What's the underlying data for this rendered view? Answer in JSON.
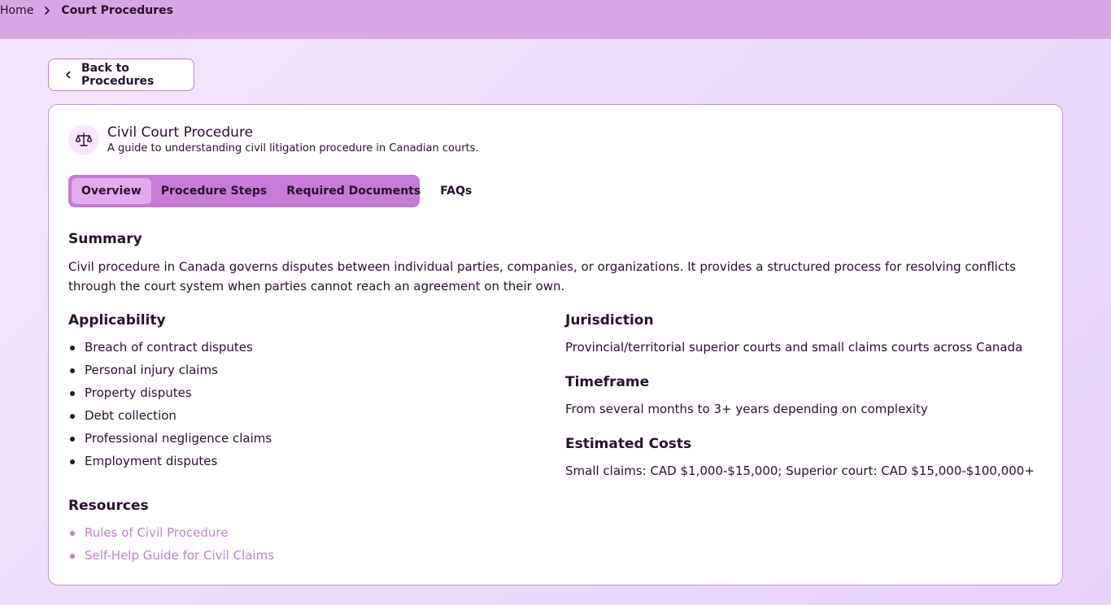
{
  "breadcrumb": {
    "home": "Home",
    "current": "Court Procedures"
  },
  "back_label": "Back to Procedures",
  "procedure": {
    "title": "Civil Court Procedure",
    "subtitle": "A guide to understanding civil litigation procedure in Canadian courts.",
    "icon": "scale-icon"
  },
  "tabs": [
    {
      "label": "Overview",
      "active": true
    },
    {
      "label": "Procedure Steps",
      "active": false
    },
    {
      "label": "Required Documents",
      "active": false
    },
    {
      "label": "FAQs",
      "active": false
    }
  ],
  "summary": {
    "heading": "Summary",
    "text": "Civil procedure in Canada governs disputes between individual parties, companies, or organizations. It provides a structured process for resolving conflicts through the court system when parties cannot reach an agreement on their own."
  },
  "applicability": {
    "heading": "Applicability",
    "items": [
      "Breach of contract disputes",
      "Personal injury claims",
      "Property disputes",
      "Debt collection",
      "Professional negligence claims",
      "Employment disputes"
    ]
  },
  "jurisdiction": {
    "heading": "Jurisdiction",
    "text": "Provincial/territorial superior courts and small claims courts across Canada"
  },
  "timeframe": {
    "heading": "Timeframe",
    "text": "From several months to 3+ years depending on complexity"
  },
  "costs": {
    "heading": "Estimated Costs",
    "text": "Small claims: CAD $1,000-$15,000; Superior court: CAD $15,000-$100,000+"
  },
  "resources": {
    "heading": "Resources",
    "links": [
      "Rules of Civil Procedure",
      "Self-Help Guide for Civil Claims"
    ]
  },
  "colors": {
    "accent": "#c77ad8",
    "topbar": "#d8a6e4",
    "text": "#2a0f2e"
  }
}
